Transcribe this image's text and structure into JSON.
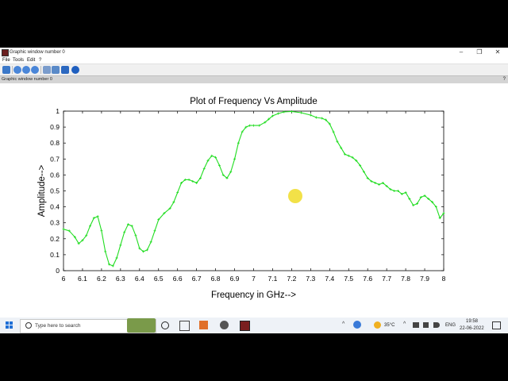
{
  "window": {
    "title": "Graphic window number 0",
    "minimize_glyph": "–",
    "maximize_glyph": "❐",
    "close_glyph": "✕"
  },
  "menu": [
    "File",
    "Tools",
    "Edit",
    "?"
  ],
  "toolbar": {
    "icons": [
      "rotate-icon",
      "zoom-in-icon",
      "zoom-out-icon",
      "zoom-reset-icon",
      "copy-icon",
      "datatip-icon",
      "pan-icon",
      "help-icon"
    ]
  },
  "status_strip": {
    "label": "Graphic window number 0",
    "help": "?"
  },
  "chart_data": {
    "type": "line",
    "title": "Plot of Frequency Vs Amplitude",
    "xlabel": "Frequency in GHz-->",
    "ylabel": "Amplitude-->",
    "xlim": [
      6,
      8
    ],
    "ylim": [
      0,
      1
    ],
    "xticks": [
      "6",
      "6.1",
      "6.2",
      "6.3",
      "6.4",
      "6.5",
      "6.6",
      "6.7",
      "6.8",
      "6.9",
      "7",
      "7.1",
      "7.2",
      "7.3",
      "7.4",
      "7.5",
      "7.6",
      "7.7",
      "7.8",
      "7.9",
      "8"
    ],
    "yticks": [
      "0",
      "0.1",
      "0.2",
      "0.3",
      "0.4",
      "0.5",
      "0.6",
      "0.7",
      "0.8",
      "0.9",
      "1"
    ],
    "grid": false,
    "series": [
      {
        "color": "#22dd22",
        "x": [
          6.0,
          6.03,
          6.06,
          6.08,
          6.1,
          6.12,
          6.14,
          6.16,
          6.18,
          6.2,
          6.22,
          6.24,
          6.26,
          6.28,
          6.3,
          6.32,
          6.34,
          6.36,
          6.38,
          6.4,
          6.42,
          6.44,
          6.46,
          6.48,
          6.5,
          6.53,
          6.56,
          6.58,
          6.6,
          6.62,
          6.64,
          6.66,
          6.68,
          6.7,
          6.72,
          6.74,
          6.76,
          6.78,
          6.8,
          6.82,
          6.84,
          6.86,
          6.88,
          6.9,
          6.92,
          6.94,
          6.96,
          6.98,
          7.0,
          7.03,
          7.06,
          7.08,
          7.1,
          7.13,
          7.16,
          7.2,
          7.25,
          7.3,
          7.33,
          7.36,
          7.38,
          7.4,
          7.42,
          7.44,
          7.46,
          7.48,
          7.5,
          7.52,
          7.54,
          7.56,
          7.58,
          7.6,
          7.62,
          7.64,
          7.66,
          7.68,
          7.7,
          7.72,
          7.74,
          7.76,
          7.78,
          7.8,
          7.82,
          7.84,
          7.86,
          7.88,
          7.9,
          7.92,
          7.94,
          7.96,
          7.98,
          8.0
        ],
        "y": [
          0.26,
          0.25,
          0.21,
          0.17,
          0.19,
          0.22,
          0.28,
          0.33,
          0.34,
          0.25,
          0.12,
          0.04,
          0.03,
          0.08,
          0.16,
          0.24,
          0.29,
          0.28,
          0.22,
          0.14,
          0.12,
          0.13,
          0.18,
          0.25,
          0.32,
          0.36,
          0.39,
          0.43,
          0.49,
          0.55,
          0.57,
          0.57,
          0.56,
          0.55,
          0.58,
          0.64,
          0.69,
          0.72,
          0.71,
          0.66,
          0.6,
          0.58,
          0.62,
          0.7,
          0.8,
          0.87,
          0.9,
          0.91,
          0.91,
          0.91,
          0.93,
          0.95,
          0.97,
          0.985,
          0.995,
          0.998,
          0.99,
          0.975,
          0.96,
          0.955,
          0.945,
          0.92,
          0.87,
          0.81,
          0.77,
          0.73,
          0.72,
          0.71,
          0.69,
          0.66,
          0.62,
          0.58,
          0.56,
          0.55,
          0.54,
          0.55,
          0.53,
          0.51,
          0.5,
          0.5,
          0.48,
          0.49,
          0.45,
          0.41,
          0.42,
          0.46,
          0.47,
          0.45,
          0.43,
          0.4,
          0.33,
          0.36
        ]
      }
    ]
  },
  "taskbar": {
    "search_placeholder": "Type here to search",
    "temperature": "35°C",
    "language": "ENG",
    "time": "19:58",
    "date": "22-06-2022"
  }
}
